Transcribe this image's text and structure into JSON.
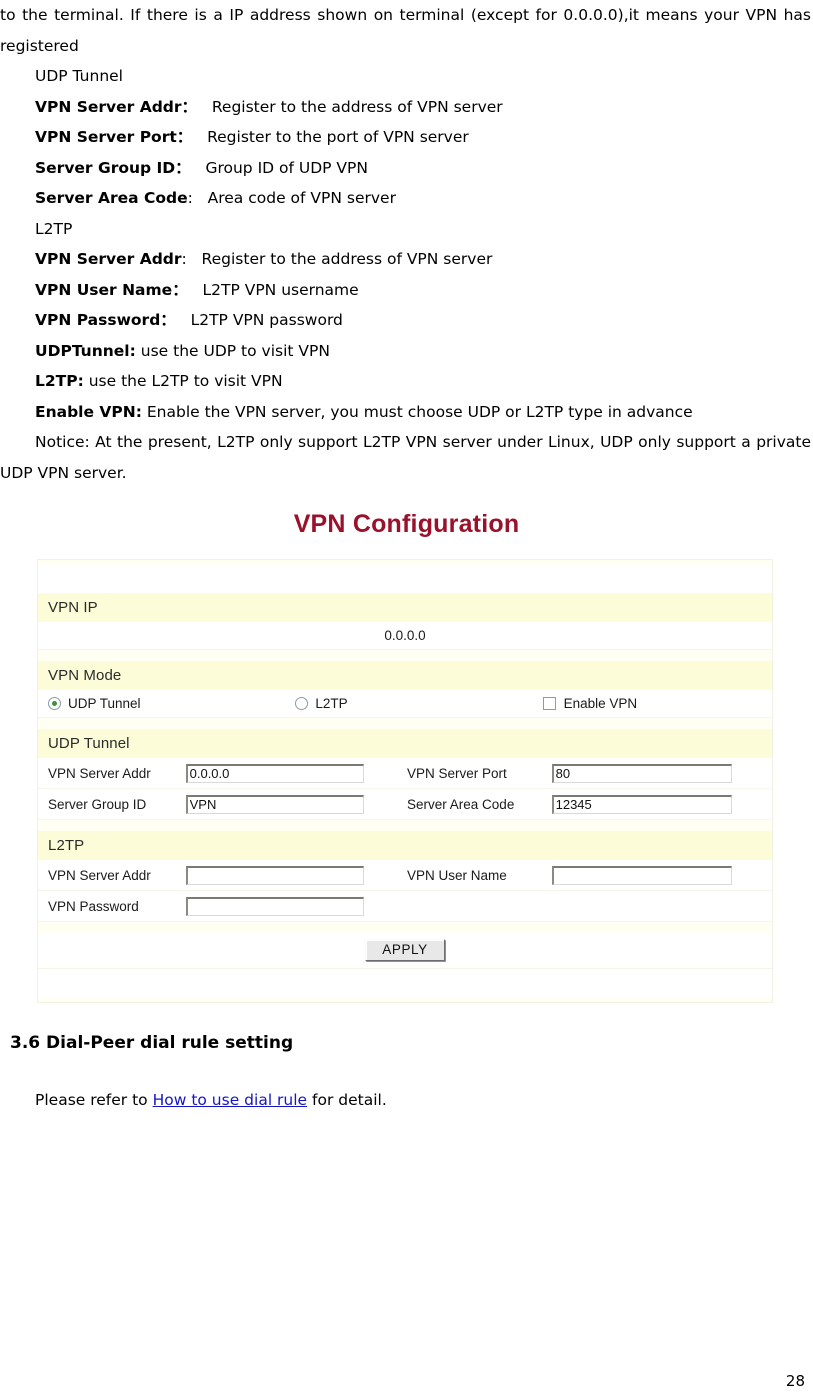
{
  "document": {
    "intro_paragraph": "to the terminal. If there is a IP address shown on terminal (except for 0.0.0.0),it means your VPN has registered",
    "definitions": [
      {
        "term": "",
        "term_bold": false,
        "desc": "UDP Tunnel"
      },
      {
        "term": "VPN Server Addr",
        "term_bold": true,
        "sep": "：",
        "desc": "Register to the address of VPN server"
      },
      {
        "term": "VPN Server Port",
        "term_bold": true,
        "sep": "：",
        "desc": "Register to the port of VPN server"
      },
      {
        "term": "Server Group ID",
        "term_bold": true,
        "sep": "：",
        "desc": "Group ID of UDP VPN"
      },
      {
        "term": "Server Area Code",
        "term_bold": true,
        "sep": ":",
        "desc": "Area code of VPN server"
      },
      {
        "term": "",
        "term_bold": false,
        "desc": "L2TP"
      },
      {
        "term": "VPN Server Addr",
        "term_bold": true,
        "sep": ":",
        "desc": "Register to the address of VPN server"
      },
      {
        "term": "VPN User Name",
        "term_bold": true,
        "sep": "：",
        "desc": "L2TP VPN username"
      },
      {
        "term": "VPN Password",
        "term_bold": true,
        "sep": "：",
        "desc": "L2TP VPN password"
      },
      {
        "term": "UDPTunnel:",
        "term_bold": true,
        "sep": "",
        "desc": "use the UDP to visit VPN"
      },
      {
        "term": "L2TP:",
        "term_bold": true,
        "sep": "",
        "desc": "use the L2TP to visit VPN"
      }
    ],
    "enable_vpn_term": "Enable VPN:",
    "enable_vpn_desc": "Enable the VPN server, you must choose UDP or L2TP type in advance",
    "notice": "Notice: At the present, L2TP only support L2TP VPN server under Linux, UDP only support a private UDP VPN server.",
    "section_heading": "3.6 Dial-Peer dial rule setting",
    "refer_prefix": "Please refer to ",
    "refer_link": "How to use dial rule",
    "refer_suffix": " for detail.",
    "page_number": "28"
  },
  "figure": {
    "title": "VPN Configuration",
    "title_color": "#99112b",
    "band_color": "#fcfcd8",
    "panel_bg": "#fffff3",
    "sections": {
      "vpn_ip": {
        "band_label": "VPN IP",
        "value": "0.0.0.0"
      },
      "vpn_mode": {
        "band_label": "VPN Mode",
        "options": [
          {
            "label": "UDP Tunnel",
            "type": "radio",
            "checked": true
          },
          {
            "label": "L2TP",
            "type": "radio",
            "checked": false
          },
          {
            "label": "Enable VPN",
            "type": "checkbox",
            "checked": false
          }
        ]
      },
      "udp_tunnel": {
        "band_label": "UDP Tunnel",
        "fields": [
          {
            "label": "VPN Server Addr",
            "value": "0.0.0.0"
          },
          {
            "label": "VPN Server Port",
            "value": "80"
          },
          {
            "label": "Server Group ID",
            "value": "VPN"
          },
          {
            "label": "Server Area Code",
            "value": "12345"
          }
        ]
      },
      "l2tp": {
        "band_label": "L2TP",
        "fields": [
          {
            "label": "VPN Server Addr",
            "value": ""
          },
          {
            "label": "VPN User Name",
            "value": ""
          },
          {
            "label": "VPN Password",
            "value": ""
          }
        ]
      }
    },
    "apply_label": "APPLY"
  }
}
